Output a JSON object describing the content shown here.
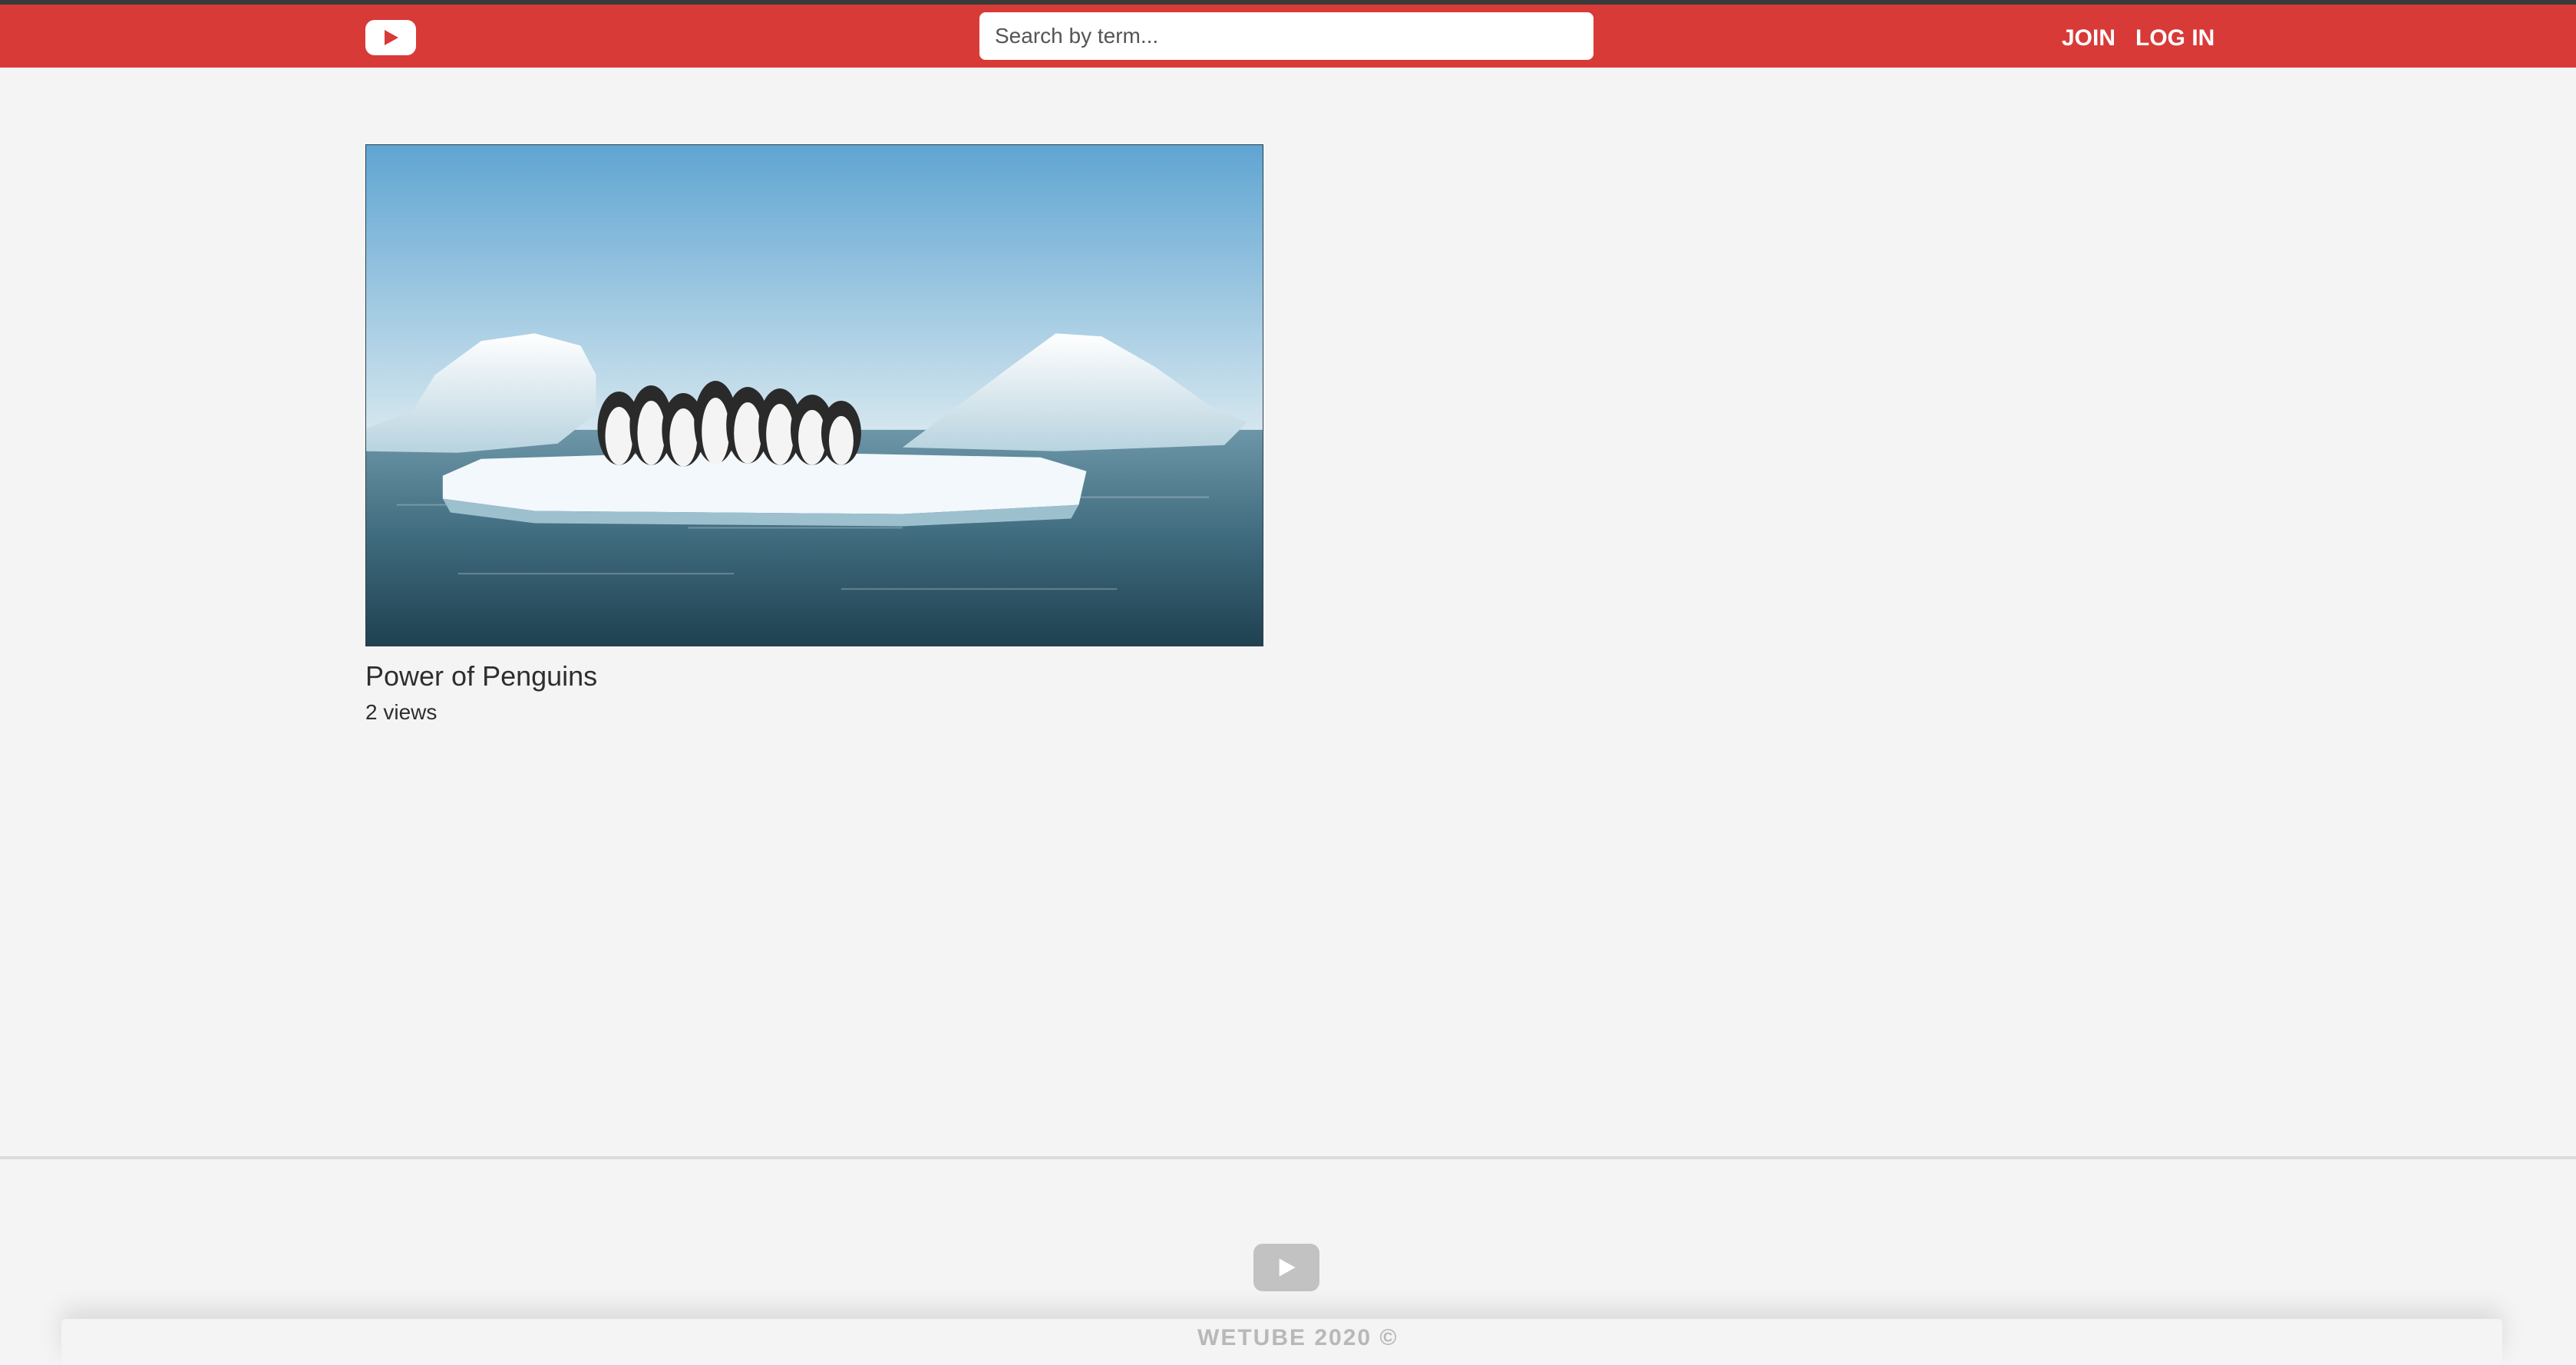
{
  "colors": {
    "header_bg": "#d83a37",
    "page_bg": "#f4f4f4",
    "text": "#2e2e2e",
    "footer_logo": "#c2c2c2"
  },
  "header": {
    "logo_icon": "youtube-play-icon",
    "search_placeholder": "Search by term...",
    "join_label": "JOIN",
    "login_label": "LOG IN"
  },
  "videos": [
    {
      "thumbnail": "penguins-on-iceberg",
      "title": "Power of Penguins",
      "views": "2 views"
    }
  ],
  "footer": {
    "logo_icon": "youtube-play-icon",
    "text": "WETUBE 2020 ©"
  }
}
